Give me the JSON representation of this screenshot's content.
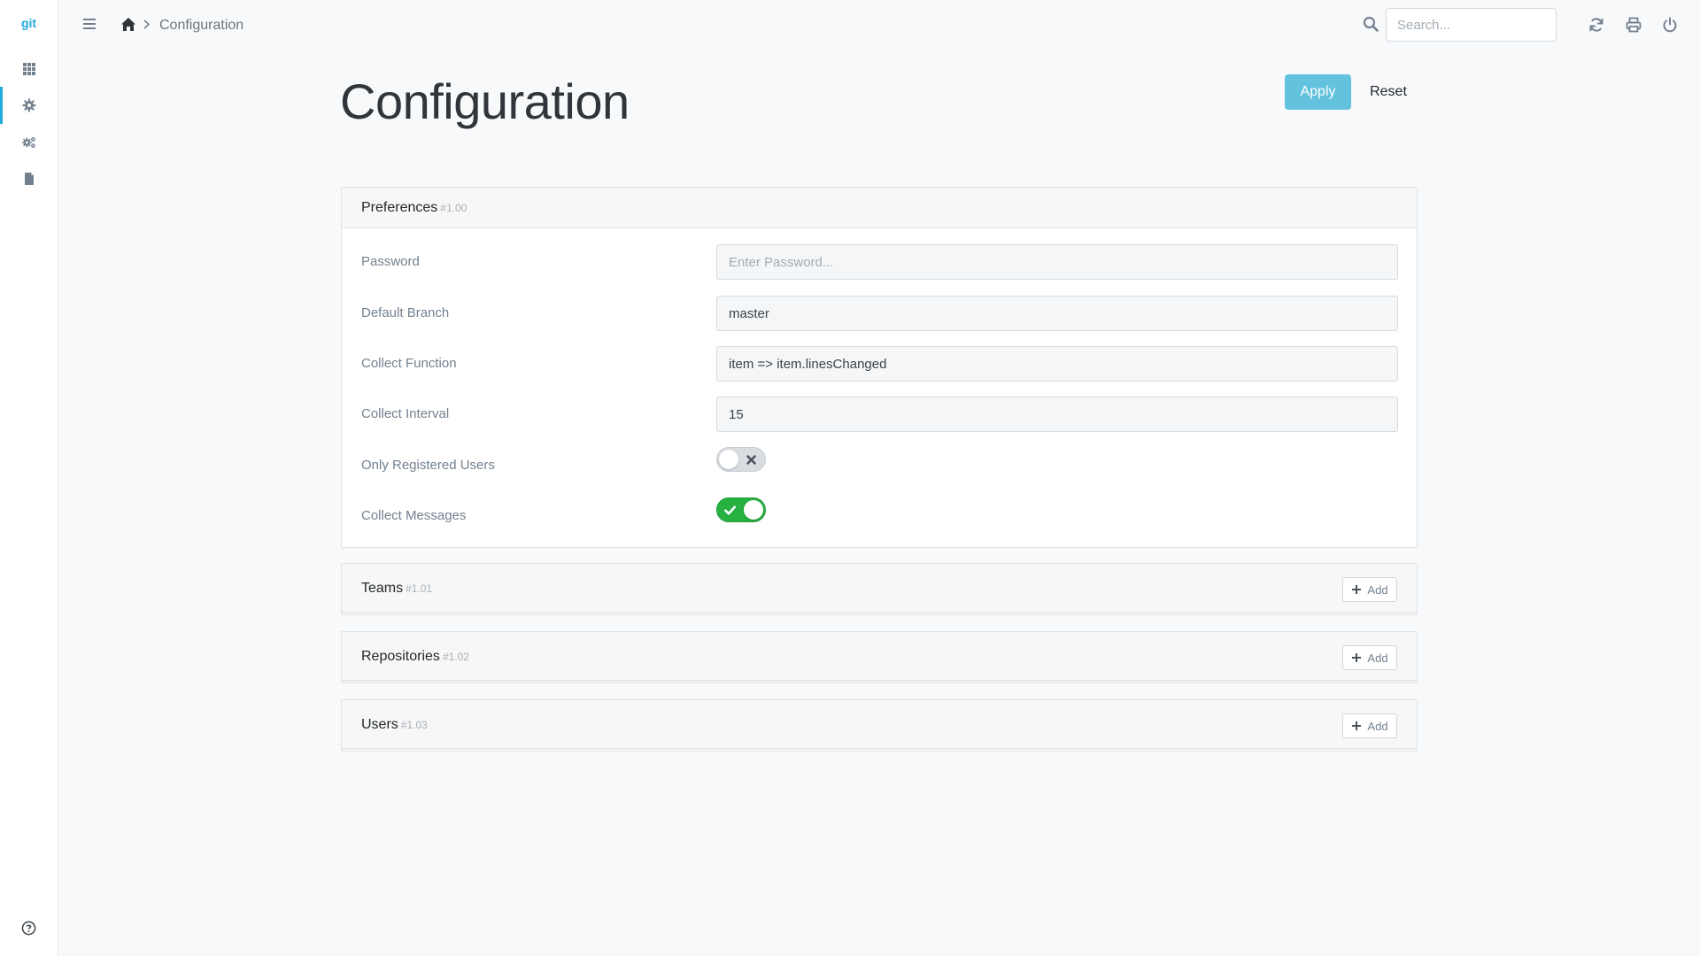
{
  "app": {
    "logo_text": "git"
  },
  "sidebar": {
    "items": [
      {
        "icon": "grid-icon",
        "active": false
      },
      {
        "icon": "gear-icon",
        "active": true
      },
      {
        "icon": "gears-icon",
        "active": false
      },
      {
        "icon": "document-icon",
        "active": false
      }
    ],
    "help_icon": "question-circle-icon"
  },
  "topbar": {
    "breadcrumb": {
      "home_icon": "home-icon",
      "current": "Configuration"
    },
    "search": {
      "placeholder": "Search..."
    },
    "icons": [
      "refresh-icon",
      "print-icon",
      "power-icon"
    ]
  },
  "page": {
    "title": "Configuration",
    "apply_label": "Apply",
    "reset_label": "Reset"
  },
  "preferences": {
    "title": "Preferences",
    "id": "#1.00",
    "fields": {
      "password": {
        "label": "Password",
        "value": "",
        "placeholder": "Enter Password..."
      },
      "default_branch": {
        "label": "Default Branch",
        "value": "master"
      },
      "collect_function": {
        "label": "Collect Function",
        "value": "item => item.linesChanged"
      },
      "collect_interval": {
        "label": "Collect Interval",
        "value": "15"
      },
      "only_registered_users": {
        "label": "Only Registered Users",
        "enabled": false
      },
      "collect_messages": {
        "label": "Collect Messages",
        "enabled": true
      }
    }
  },
  "sections": [
    {
      "title": "Teams",
      "id": "#1.01",
      "add_label": "Add"
    },
    {
      "title": "Repositories",
      "id": "#1.02",
      "add_label": "Add"
    },
    {
      "title": "Users",
      "id": "#1.03",
      "add_label": "Add"
    }
  ],
  "colors": {
    "accent": "#20a8d8",
    "apply_button": "#63c2de",
    "toggle_on": "#26b141",
    "toggle_off": "#d8dde2"
  }
}
